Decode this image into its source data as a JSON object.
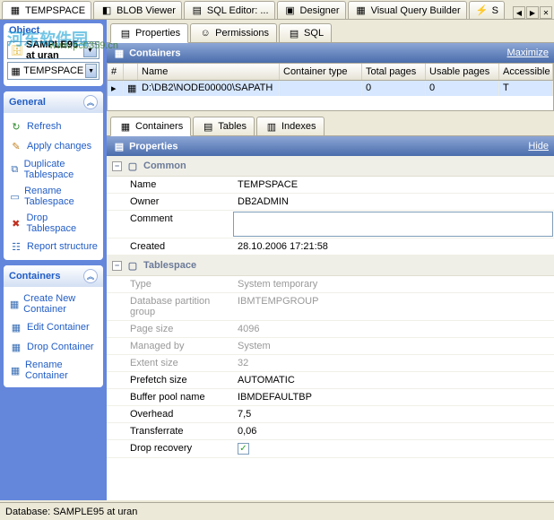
{
  "topTabs": [
    {
      "label": "TEMPSPACE",
      "icon": "tablespace"
    },
    {
      "label": "BLOB Viewer",
      "icon": "blob"
    },
    {
      "label": "SQL Editor: ...",
      "icon": "sql"
    },
    {
      "label": "Designer",
      "icon": "designer"
    },
    {
      "label": "Visual Query Builder",
      "icon": "vqb"
    },
    {
      "label": "S",
      "icon": "lightning"
    }
  ],
  "watermark": "河东软件园",
  "watermark_url": "www.pc0359.cn",
  "sidebar": {
    "object_label": "Object",
    "db_value": "SAMPLE95 at uran",
    "obj_value": "TEMPSPACE",
    "general": {
      "title": "General",
      "items": [
        {
          "label": "Refresh",
          "icon": "refresh",
          "color": "#2e8b2e"
        },
        {
          "label": "Apply changes",
          "icon": "apply",
          "color": "#c08020"
        },
        {
          "label": "Duplicate Tablespace",
          "icon": "duplicate",
          "color": "#3a6fb5"
        },
        {
          "label": "Rename Tablespace",
          "icon": "rename",
          "color": "#3a6fb5"
        },
        {
          "label": "Drop Tablespace",
          "icon": "drop",
          "color": "#c03020"
        },
        {
          "label": "Report structure",
          "icon": "report",
          "color": "#3a6fb5"
        }
      ]
    },
    "containers": {
      "title": "Containers",
      "items": [
        {
          "label": "Create New Container",
          "icon": "create",
          "color": "#3a6fb5"
        },
        {
          "label": "Edit Container",
          "icon": "edit",
          "color": "#3a6fb5"
        },
        {
          "label": "Drop Container",
          "icon": "dropcontainer",
          "color": "#3a6fb5"
        },
        {
          "label": "Rename Container",
          "icon": "renamecontainer",
          "color": "#3a6fb5"
        }
      ]
    }
  },
  "propTabs": [
    {
      "label": "Properties",
      "icon": "props",
      "active": true
    },
    {
      "label": "Permissions",
      "icon": "perms"
    },
    {
      "label": "SQL",
      "icon": "sql"
    }
  ],
  "containers_section": {
    "title": "Containers",
    "maximize": "Maximize",
    "columns": [
      "#",
      "",
      "Name",
      "Container type",
      "Total pages",
      "Usable pages",
      "Accessible"
    ],
    "row": {
      "num": "",
      "name": "D:\\DB2\\NODE00000\\SAPATH",
      "type": "",
      "total": "0",
      "usable": "0",
      "acc": "T"
    }
  },
  "innerTabs": [
    {
      "label": "Containers",
      "icon": "containers",
      "active": true
    },
    {
      "label": "Tables",
      "icon": "tables"
    },
    {
      "label": "Indexes",
      "icon": "indexes"
    }
  ],
  "properties_section": {
    "title": "Properties",
    "hide": "Hide",
    "groups": [
      {
        "name": "Common",
        "rows": [
          {
            "label": "Name",
            "value": "TEMPSPACE",
            "dim": false
          },
          {
            "label": "Owner",
            "value": "DB2ADMIN",
            "dim": false
          },
          {
            "label": "Comment",
            "value": "",
            "dim": false,
            "editable": true
          },
          {
            "label": "Created",
            "value": "28.10.2006 17:21:58",
            "dim": false
          }
        ]
      },
      {
        "name": "Tablespace",
        "rows": [
          {
            "label": "Type",
            "value": "System temporary",
            "dim": true
          },
          {
            "label": "Database partition group",
            "value": "IBMTEMPGROUP",
            "dim": true
          },
          {
            "label": "Page size",
            "value": "4096",
            "dim": true
          },
          {
            "label": "Managed by",
            "value": "System",
            "dim": true
          },
          {
            "label": "Extent size",
            "value": "32",
            "dim": true
          },
          {
            "label": "Prefetch size",
            "value": "AUTOMATIC",
            "dim": false
          },
          {
            "label": "Buffer pool name",
            "value": "IBMDEFAULTBP",
            "dim": false
          },
          {
            "label": "Overhead",
            "value": "7,5",
            "dim": false
          },
          {
            "label": "Transferrate",
            "value": "0,06",
            "dim": false
          },
          {
            "label": "Drop recovery",
            "value": "",
            "dim": false,
            "checkbox": true,
            "checked": true
          }
        ]
      }
    ]
  },
  "statusbar": "Database: SAMPLE95 at uran"
}
